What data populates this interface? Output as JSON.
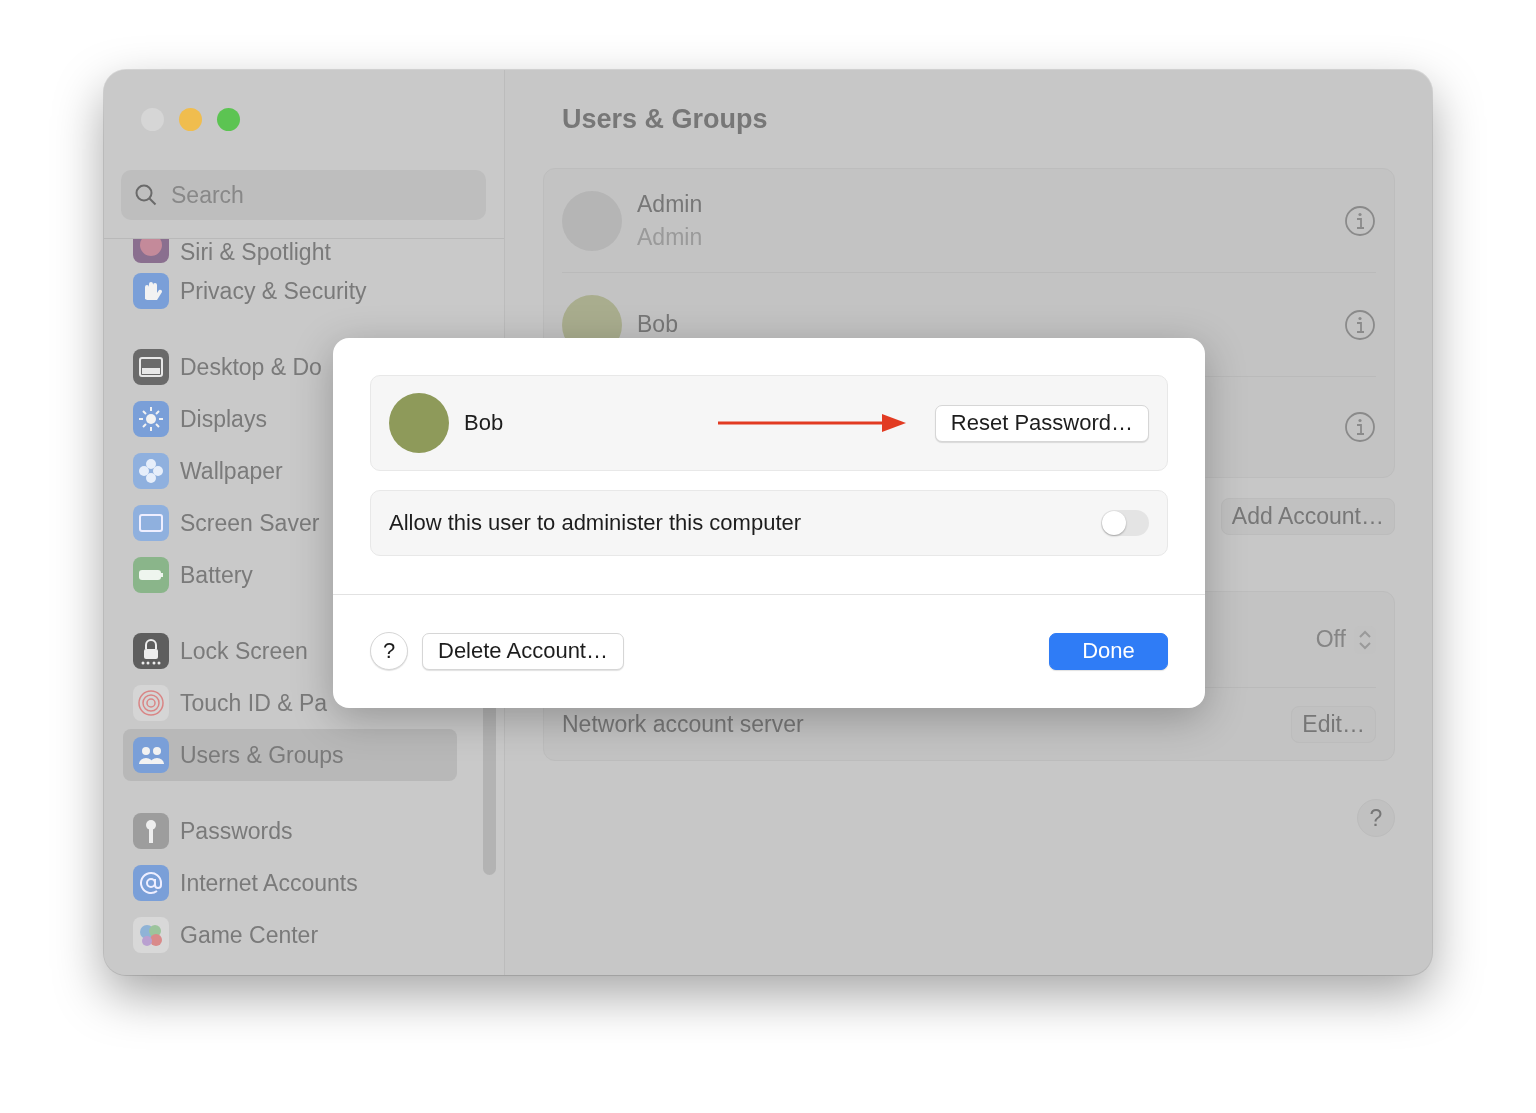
{
  "sidebar": {
    "search": {
      "placeholder": "Search"
    },
    "sections": [
      {
        "items": [
          {
            "label": "Siri & Spotlight",
            "kind": "siri",
            "selected": false
          },
          {
            "label": "Privacy & Security",
            "kind": "hand",
            "selected": false
          }
        ]
      },
      {
        "items": [
          {
            "label": "Desktop & Do",
            "kind": "desktop",
            "selected": false
          },
          {
            "label": "Displays",
            "kind": "sun",
            "selected": false
          },
          {
            "label": "Wallpaper",
            "kind": "flower",
            "selected": false
          },
          {
            "label": "Screen Saver",
            "kind": "screen",
            "selected": false
          },
          {
            "label": "Battery",
            "kind": "battery",
            "selected": false
          }
        ]
      },
      {
        "items": [
          {
            "label": "Lock Screen",
            "kind": "lock",
            "selected": false
          },
          {
            "label": "Touch ID & Pa",
            "kind": "fingerprint",
            "selected": false
          },
          {
            "label": "Users & Groups",
            "kind": "users",
            "selected": true
          }
        ]
      },
      {
        "items": [
          {
            "label": "Passwords",
            "kind": "key",
            "selected": false
          },
          {
            "label": "Internet Accounts",
            "kind": "at",
            "selected": false
          },
          {
            "label": "Game Center",
            "kind": "bubbles",
            "selected": false
          }
        ]
      }
    ]
  },
  "main": {
    "title": "Users & Groups",
    "users": [
      {
        "name": "Admin",
        "role": "Admin",
        "kind": "person"
      },
      {
        "name": "Bob",
        "kind": "photo"
      }
    ],
    "add_account_button": "Add Account…",
    "settings": [
      {
        "kind": "popup",
        "value": "Off"
      },
      {
        "kind": "button",
        "label": "Network account server",
        "button": "Edit…"
      }
    ],
    "help_button": "?"
  },
  "sheet": {
    "user": {
      "name": "Bob"
    },
    "reset_button": "Reset Password…",
    "admin_toggle": {
      "label": "Allow this user to administer this computer",
      "on": false
    },
    "help_button": "?",
    "delete_button": "Delete Account…",
    "done_button": "Done"
  }
}
